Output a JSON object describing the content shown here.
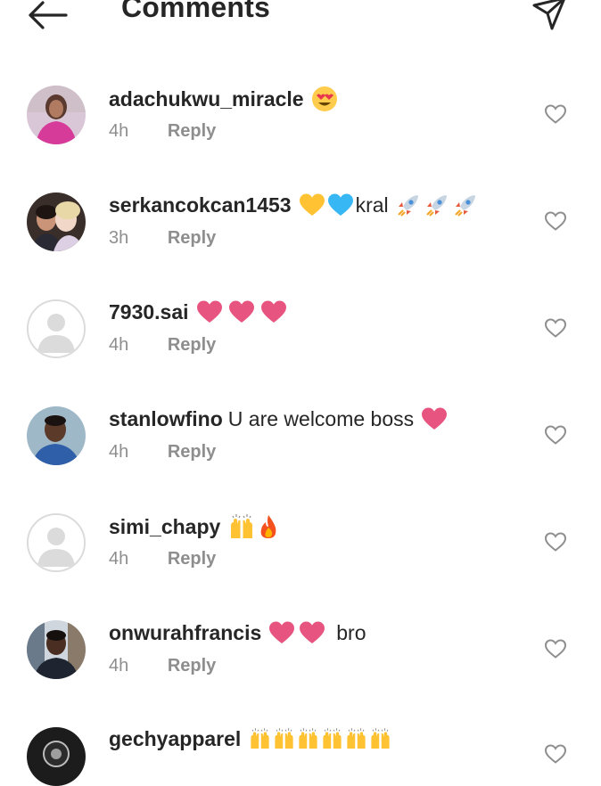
{
  "header": {
    "title": "Comments",
    "back_icon": "arrow-left-icon",
    "send_icon": "paper-plane-icon"
  },
  "colors": {
    "text": "#262626",
    "muted": "#8e8e8e",
    "heart_pink": "#e75480"
  },
  "comments": [
    {
      "username": "adachukwu_miracle",
      "text": "",
      "emojis": [
        "heart-eyes"
      ],
      "time": "4h",
      "reply_label": "Reply",
      "avatar": "photo-woman-pink"
    },
    {
      "username": "serkancokcan1453",
      "text": "kral",
      "emojis_before_text": [
        "yellow-heart",
        "blue-heart"
      ],
      "emojis": [
        "rocket",
        "rocket",
        "rocket"
      ],
      "time": "3h",
      "reply_label": "Reply",
      "avatar": "photo-couple"
    },
    {
      "username": "7930.sai",
      "text": "",
      "emojis": [
        "pink-heart",
        "pink-heart",
        "pink-heart"
      ],
      "time": "4h",
      "reply_label": "Reply",
      "avatar": "default"
    },
    {
      "username": "stanlowfino",
      "text": "U are welcome boss",
      "emojis": [
        "pink-heart"
      ],
      "time": "4h",
      "reply_label": "Reply",
      "avatar": "photo-man-blue"
    },
    {
      "username": "simi_chapy",
      "text": "",
      "emojis": [
        "raising-hands",
        "fire"
      ],
      "time": "4h",
      "reply_label": "Reply",
      "avatar": "default"
    },
    {
      "username": "onwurahfrancis",
      "text": "bro",
      "emojis_before_text": [
        "pink-heart",
        "pink-heart"
      ],
      "emojis": [],
      "time": "4h",
      "reply_label": "Reply",
      "avatar": "photo-man-street"
    },
    {
      "username": "gechyapparel",
      "text": "",
      "emojis": [
        "raising-hands",
        "raising-hands",
        "raising-hands",
        "raising-hands",
        "raising-hands",
        "raising-hands"
      ],
      "time": "",
      "reply_label": "",
      "avatar": "photo-dark-logo"
    }
  ]
}
